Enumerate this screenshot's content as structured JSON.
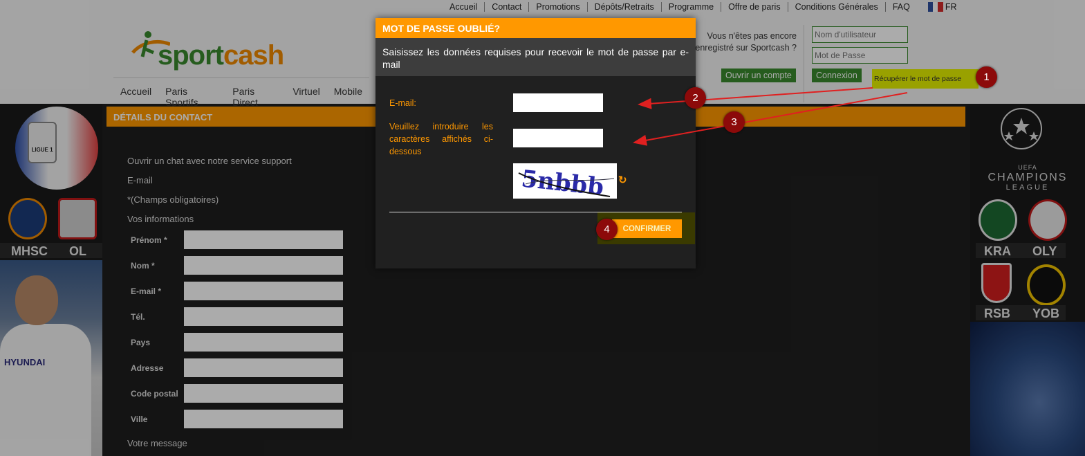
{
  "top_nav": {
    "items": [
      "Accueil",
      "Contact",
      "Promotions",
      "Dépôts/Retraits",
      "Programme",
      "Offre de paris",
      "Conditions Générales",
      "FAQ"
    ],
    "language": "FR",
    "flag_colors": [
      "#2f4f9f",
      "#ffffff",
      "#d22a2a"
    ]
  },
  "logo": {
    "part1": "sport",
    "part2": "cash"
  },
  "main_nav": {
    "items": [
      "Accueil",
      "Paris Sportifs",
      "Paris Direct",
      "Virtuel",
      "Mobile"
    ]
  },
  "header_right": {
    "register_text": "Vous n'êtes pas encore enregistré sur Sportcash ?",
    "username_placeholder": "Nom d'utilisateur",
    "password_placeholder": "Mot de Passe",
    "open_account_label": "Ouvrir un compte",
    "login_label": "Connexion",
    "recover_password_label": "Récupérer le mot de passe"
  },
  "left_banner": {
    "ball_label": "LIGUE 1",
    "team1": "MHSC",
    "team2": "OL",
    "player_sponsor": "HYUNDAI"
  },
  "right_banner": {
    "uefa": "UEFA",
    "competition": "CHAMPIONS",
    "league": "LEAGUE",
    "match1": {
      "home": "KRA",
      "away": "OLY"
    },
    "match2": {
      "home": "RSB",
      "away": "YOB"
    }
  },
  "contact": {
    "header": "DÉTAILS DU CONTACT",
    "chat_text": "Ouvrir un chat avec notre service support",
    "email_text": "E-mail",
    "required_note": "*(Champs obligatoires)",
    "your_info": "Vos informations",
    "fields": [
      {
        "label": "Prénom *"
      },
      {
        "label": "Nom *"
      },
      {
        "label": "E-mail *"
      },
      {
        "label": "Tél."
      },
      {
        "label": "Pays"
      },
      {
        "label": "Adresse"
      },
      {
        "label": "Code postal"
      },
      {
        "label": "Ville"
      }
    ],
    "message_label": "Votre message"
  },
  "modal": {
    "title": "MOT DE PASSE OUBLIÉ?",
    "subtitle": "Saisissez les données requises pour recevoir le mot de passe par e-mail",
    "email_label": "E-mail:",
    "captcha_label": "Veuillez introduire les caractères affichés ci-dessous",
    "captcha_text": "5nbbb",
    "refresh_icon": "refresh-icon",
    "confirm_label": "CONFIRMER"
  },
  "annotations": {
    "markers": [
      "1",
      "2",
      "3",
      "4"
    ],
    "arrow_color": "#e02020",
    "marker_color": "#8c0a0a"
  }
}
